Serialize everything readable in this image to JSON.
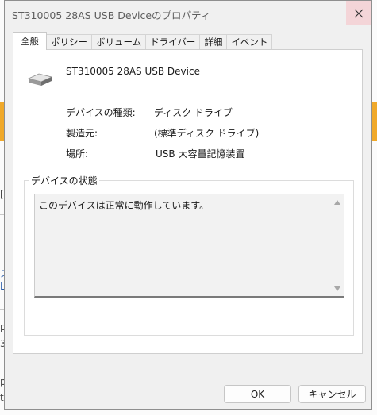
{
  "window": {
    "title": "ST310005 28AS USB Deviceのプロパティ",
    "close_icon": "close-icon"
  },
  "tabs": [
    {
      "label": "全般",
      "active": true
    },
    {
      "label": "ポリシー"
    },
    {
      "label": "ボリューム"
    },
    {
      "label": "ドライバー"
    },
    {
      "label": "詳細"
    },
    {
      "label": "イベント"
    }
  ],
  "general": {
    "device_icon": "drive-icon",
    "device_name": "ST310005 28AS USB Device",
    "properties": [
      {
        "label": "デバイスの種類:",
        "value": "ディスク ドライブ"
      },
      {
        "label": "製造元:",
        "value": "(標準ディスク ドライブ)"
      },
      {
        "label": "場所:",
        "value": "USB 大容量記憶装置"
      }
    ],
    "status_group_title": "デバイスの状態",
    "status_text": "このデバイスは正常に動作しています。"
  },
  "buttons": {
    "ok": "OK",
    "cancel": "キャンセル"
  },
  "background": {
    "fragments": [
      "[",
      "ス",
      "L",
      "p",
      "3",
      "p",
      "t"
    ]
  }
}
